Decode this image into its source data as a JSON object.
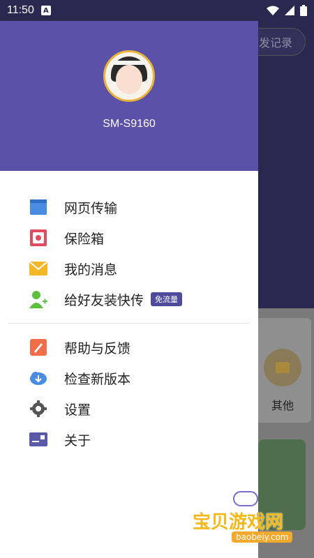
{
  "status_bar": {
    "time": "11:50",
    "notification_letter": "A"
  },
  "background": {
    "record_button": "发记录",
    "other_label": "其他"
  },
  "drawer": {
    "device_name": "SM-S9160",
    "items_top": [
      {
        "label": "网页传输",
        "icon": "web-transfer-icon"
      },
      {
        "label": "保险箱",
        "icon": "safe-icon"
      },
      {
        "label": "我的消息",
        "icon": "message-icon"
      },
      {
        "label": "给好友装快传",
        "icon": "invite-friend-icon",
        "badge": "免流量"
      }
    ],
    "items_bottom": [
      {
        "label": "帮助与反馈",
        "icon": "help-feedback-icon"
      },
      {
        "label": "检查新版本",
        "icon": "update-icon"
      },
      {
        "label": "设置",
        "icon": "gear-icon"
      },
      {
        "label": "关于",
        "icon": "about-icon"
      }
    ]
  },
  "watermark": {
    "text": "宝贝游戏网",
    "url": "baobeiy.com"
  },
  "colors": {
    "header": "#5b51a8",
    "status_bar": "#2b2850",
    "badge": "#4e4a9c"
  }
}
